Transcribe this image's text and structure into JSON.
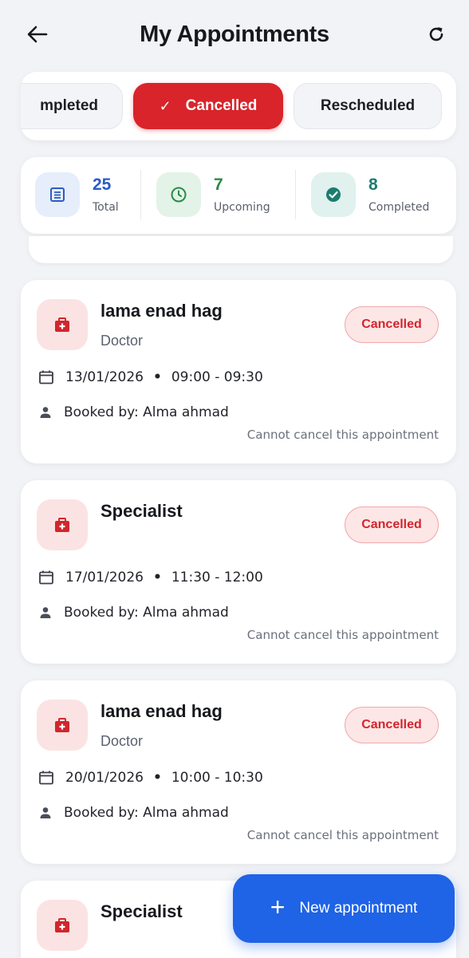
{
  "header": {
    "title": "My Appointments"
  },
  "tabs": [
    {
      "label": "mpleted",
      "active": false
    },
    {
      "label": "Cancelled",
      "active": true
    },
    {
      "label": "Rescheduled",
      "active": false
    }
  ],
  "stats": {
    "total": {
      "value": "25",
      "label": "Total",
      "color": "#2b5cc5",
      "bg": "#e6edfb"
    },
    "upcoming": {
      "value": "7",
      "label": "Upcoming",
      "color": "#2a8a48",
      "bg": "#e3f3e7"
    },
    "completed": {
      "value": "8",
      "label": "Completed",
      "color": "#1b7d6f",
      "bg": "#e0f1ee"
    }
  },
  "appointments": [
    {
      "name": "lama enad hag",
      "role": "Doctor",
      "status": "Cancelled",
      "date": "13/01/2026",
      "time": "09:00 - 09:30",
      "booked_by": "Booked by: Alma ahmad",
      "note": "Cannot cancel this appointment"
    },
    {
      "name": "Specialist",
      "role": "",
      "status": "Cancelled",
      "date": "17/01/2026",
      "time": "11:30 - 12:00",
      "booked_by": "Booked by: Alma ahmad",
      "note": "Cannot cancel this appointment"
    },
    {
      "name": "lama enad hag",
      "role": "Doctor",
      "status": "Cancelled",
      "date": "20/01/2026",
      "time": "10:00 - 10:30",
      "booked_by": "Booked by: Alma ahmad",
      "note": "Cannot cancel this appointment"
    },
    {
      "name": "Specialist"
    }
  ],
  "fab": {
    "label": "New appointment"
  },
  "separator": "•",
  "colors": {
    "accent": "#d9242b",
    "primary": "#1f63e6"
  },
  "icons": {
    "back": "arrow-left-icon",
    "refresh": "refresh-icon",
    "appointment": "medical-kit-icon",
    "date": "calendar-icon",
    "booked": "person-icon",
    "check": "check-icon",
    "plus": "plus-icon"
  }
}
